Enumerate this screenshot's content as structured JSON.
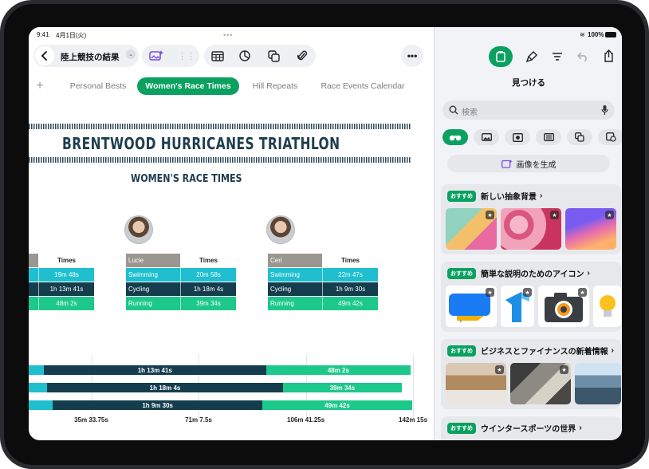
{
  "status": {
    "time": "9:41",
    "date": "4月1日(火)",
    "battery": "100%"
  },
  "toolbar": {
    "document_title": "陸上競技の結果"
  },
  "tabs": [
    {
      "label": "Personal Bests"
    },
    {
      "label": "Women's Race Times"
    },
    {
      "label": "Hill Repeats"
    },
    {
      "label": "Race Events Calendar"
    }
  ],
  "sheet": {
    "title": "BRENTWOOD HURRICANES TRIATHLON",
    "subtitle": "WOMEN'S RACE TIMES",
    "tables": [
      {
        "name": "",
        "header": "Times",
        "rows": [
          {
            "event": "",
            "time": "19m 48s"
          },
          {
            "event": "",
            "time": "1h 13m 41s"
          },
          {
            "event": "",
            "time": "48m 2s"
          }
        ]
      },
      {
        "name": "Lucie",
        "header": "Times",
        "rows": [
          {
            "event": "Swimming",
            "time": "20m 58s"
          },
          {
            "event": "Cycling",
            "time": "1h 18m 4s"
          },
          {
            "event": "Running",
            "time": "39m 34s"
          }
        ]
      },
      {
        "name": "Ceri",
        "header": "Times",
        "rows": [
          {
            "event": "Swimming",
            "time": "22m 47s"
          },
          {
            "event": "Cycling",
            "time": "1h 9m 30s"
          },
          {
            "event": "Running",
            "time": "49m 42s"
          }
        ]
      }
    ]
  },
  "chart_data": {
    "type": "bar",
    "orientation": "horizontal",
    "stacked": true,
    "unit": "minutes",
    "categories": [
      "",
      "",
      ""
    ],
    "series": [
      {
        "values": [
          19.8,
          20.97,
          22.78
        ],
        "color": "#1fbfcf"
      },
      {
        "values": [
          73.68,
          78.07,
          69.5
        ],
        "color": "#143e4e",
        "data_labels": [
          "1h 13m 41s",
          "1h 18m 4s",
          "1h 9m 30s"
        ]
      },
      {
        "values": [
          48.03,
          39.57,
          49.7
        ],
        "color": "#1dc98a",
        "data_labels": [
          "48m 2s",
          "39m 34s",
          "49m 42s"
        ]
      }
    ],
    "xticks": [
      "35m 33.75s",
      "71m 7.5s",
      "106m 41.25s",
      "142m 15s"
    ],
    "xtick_values": [
      35.5625,
      71.125,
      106.6875,
      142.25
    ],
    "xlim": [
      0,
      142.25
    ],
    "grid": true
  },
  "panel": {
    "title": "見つける",
    "search_placeholder": "検索",
    "generate_label": "画像を生成",
    "badge": "おすすめ",
    "sections": [
      {
        "title": "新しい抽象背景"
      },
      {
        "title": "簡単な説明のためのアイコン"
      },
      {
        "title": "ビジネスとファイナンスの新着情報"
      },
      {
        "title": "ウインタースポーツの世界"
      }
    ]
  },
  "colors": {
    "accent": "#0aa160",
    "swim": "#1fbfcf",
    "cycle": "#143e4e",
    "run": "#1dc98a"
  }
}
